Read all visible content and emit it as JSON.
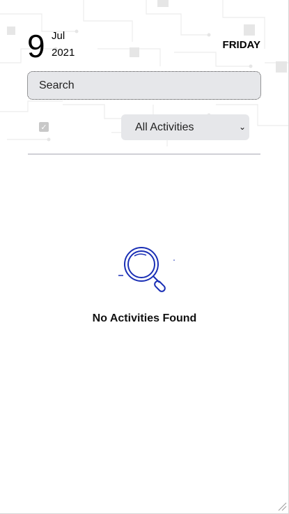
{
  "date": {
    "day": "9",
    "month": "Jul",
    "year": "2021",
    "weekday": "FRIDAY"
  },
  "search": {
    "placeholder": "Search",
    "value": ""
  },
  "filters": {
    "checkbox_checked": true,
    "select_value": "All Activities"
  },
  "empty_state": {
    "message": "No Activities Found",
    "icon": "magnifier-icon"
  },
  "colors": {
    "accent_blue": "#1a2fb5",
    "input_bg": "#e6e7ea",
    "divider": "#d0d0d6"
  }
}
